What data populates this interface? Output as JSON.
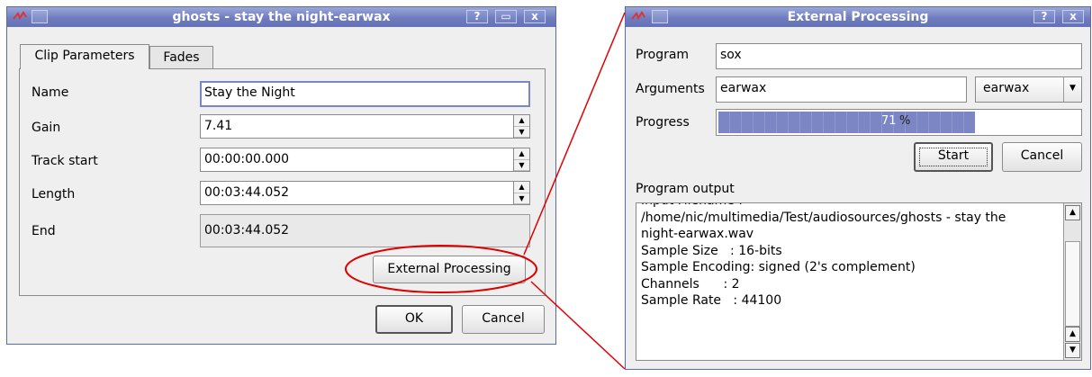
{
  "clip_dialog": {
    "title": "ghosts - stay the night-earwax",
    "titlebar_buttons": {
      "help": "?",
      "maximize": "▭",
      "close": "x"
    },
    "tabs": [
      {
        "label": "Clip Parameters",
        "active": true
      },
      {
        "label": "Fades",
        "active": false
      }
    ],
    "fields": {
      "name": {
        "label": "Name",
        "value": "Stay the Night"
      },
      "gain": {
        "label": "Gain",
        "value": "7.41"
      },
      "track_start": {
        "label": "Track start",
        "value": "00:00:00.000"
      },
      "length": {
        "label": "Length",
        "value": "00:03:44.052"
      },
      "end": {
        "label": "End",
        "value": "00:03:44.052"
      }
    },
    "external_processing_label": "External Processing",
    "ok_label": "OK",
    "cancel_label": "Cancel"
  },
  "ext_dialog": {
    "title": "External Processing",
    "titlebar_buttons": {
      "help": "?",
      "close": "x"
    },
    "program_label": "Program",
    "program_value": "sox",
    "arguments_label": "Arguments",
    "arguments_value": "earwax",
    "preset_selected": "earwax",
    "progress_label": "Progress",
    "progress_value": 0.71,
    "progress_text": "71",
    "progress_percent_sign": "%",
    "start_label": "Start",
    "cancel_label": "Cancel",
    "output_label": "Program output",
    "output_lines": [
      "Input Filename :",
      "/home/nic/multimedia/Test/audiosources/ghosts - stay the",
      "night-earwax.wav",
      "Sample Size   : 16-bits",
      "Sample Encoding: signed (2's complement)",
      "Channels      : 2",
      "Sample Rate   : 44100"
    ]
  },
  "colors": {
    "titlebar": "#6f7dbf",
    "annotation_red": "#e00000",
    "progress_fill": "#7c86c4"
  },
  "icons": [
    "app-logo-icon",
    "window-menu-icon",
    "help-icon",
    "maximize-icon",
    "close-icon",
    "chevron-up-icon",
    "chevron-down-icon"
  ]
}
